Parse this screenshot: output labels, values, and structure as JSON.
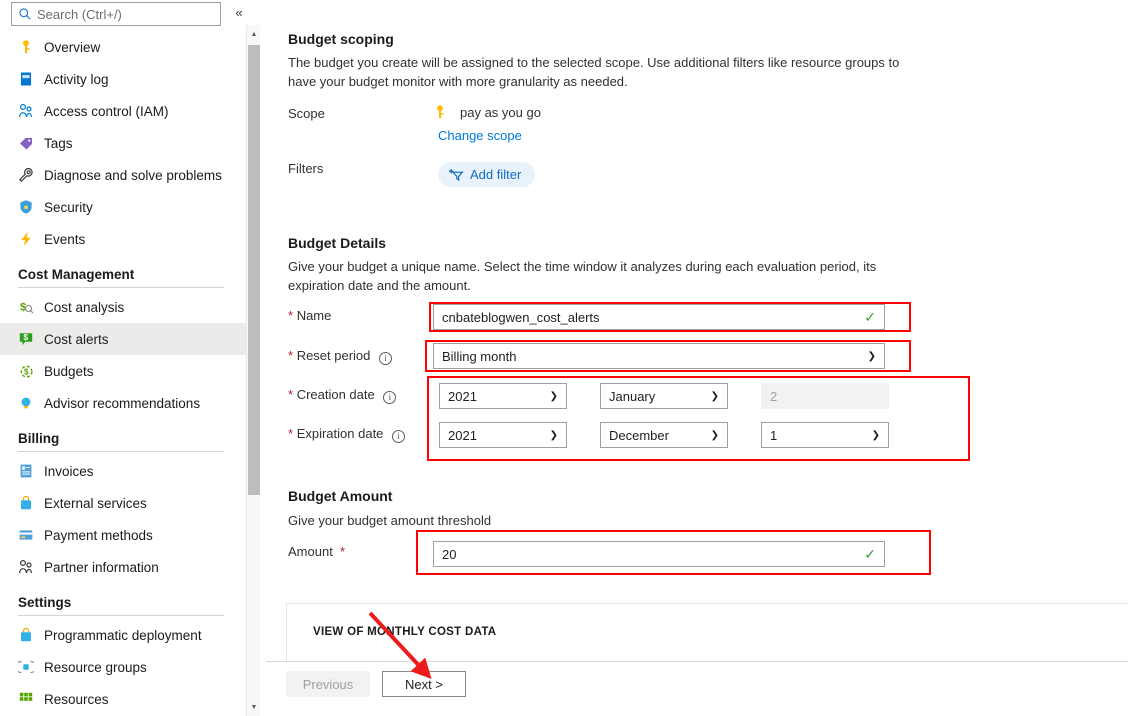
{
  "sidebar": {
    "search": {
      "placeholder": "Search (Ctrl+/)",
      "value": "",
      "icon": "search-icon"
    },
    "collapse_icon": "«",
    "items": [
      {
        "label": "Overview",
        "icon": "key-icon"
      },
      {
        "label": "Activity log",
        "icon": "activity-log-icon"
      },
      {
        "label": "Access control (IAM)",
        "icon": "people-icon"
      },
      {
        "label": "Tags",
        "icon": "tag-icon"
      },
      {
        "label": "Diagnose and solve problems",
        "icon": "wrench-icon"
      },
      {
        "label": "Security",
        "icon": "shield-icon"
      },
      {
        "label": "Events",
        "icon": "lightning-icon"
      }
    ],
    "groups": [
      {
        "title": "Cost Management",
        "items": [
          {
            "label": "Cost analysis",
            "icon": "cost-analysis-icon",
            "selected": false
          },
          {
            "label": "Cost alerts",
            "icon": "cost-alerts-icon",
            "selected": true
          },
          {
            "label": "Budgets",
            "icon": "budgets-icon",
            "selected": false
          },
          {
            "label": "Advisor recommendations",
            "icon": "advisor-icon",
            "selected": false
          }
        ]
      },
      {
        "title": "Billing",
        "items": [
          {
            "label": "Invoices",
            "icon": "invoice-icon",
            "selected": false
          },
          {
            "label": "External services",
            "icon": "external-services-icon",
            "selected": false
          },
          {
            "label": "Payment methods",
            "icon": "payment-methods-icon",
            "selected": false
          },
          {
            "label": "Partner information",
            "icon": "partner-icon",
            "selected": false
          }
        ]
      },
      {
        "title": "Settings",
        "items": [
          {
            "label": "Programmatic deployment",
            "icon": "deployment-icon",
            "selected": false
          },
          {
            "label": "Resource groups",
            "icon": "resource-groups-icon",
            "selected": false
          },
          {
            "label": "Resources",
            "icon": "resources-icon",
            "selected": false
          }
        ]
      }
    ]
  },
  "budget_scoping": {
    "title": "Budget scoping",
    "description": "The budget you create will be assigned to the selected scope. Use additional filters like resource groups to have your budget monitor with more granularity as needed.",
    "scope_label": "Scope",
    "scope_value": "pay as you go",
    "scope_icon": "key-icon",
    "change_scope_link": "Change scope",
    "filters_label": "Filters",
    "add_filter_label": "Add filter",
    "add_filter_icon": "add-filter-icon"
  },
  "budget_details": {
    "title": "Budget Details",
    "description": "Give your budget a unique name. Select the time window it analyzes during each evaluation period, its expiration date and the amount.",
    "name_label": "Name",
    "name_value": "cnbateblogwen_cost_alerts",
    "reset_period_label": "Reset period",
    "reset_period_value": "Billing month",
    "creation_date_label": "Creation date",
    "creation_year": "2021",
    "creation_month": "January",
    "creation_day": "2",
    "expiration_date_label": "Expiration date",
    "expiration_year": "2021",
    "expiration_month": "December",
    "expiration_day": "1"
  },
  "budget_amount": {
    "title": "Budget Amount",
    "description": "Give your budget amount threshold",
    "amount_label": "Amount",
    "amount_value": "20"
  },
  "cost_panel": {
    "title": "VIEW OF MONTHLY COST DATA"
  },
  "footer": {
    "previous_label": "Previous",
    "next_label": "Next >"
  },
  "annotations": {
    "highlight_color": "#ff0000",
    "arrow_target": "next-button"
  }
}
